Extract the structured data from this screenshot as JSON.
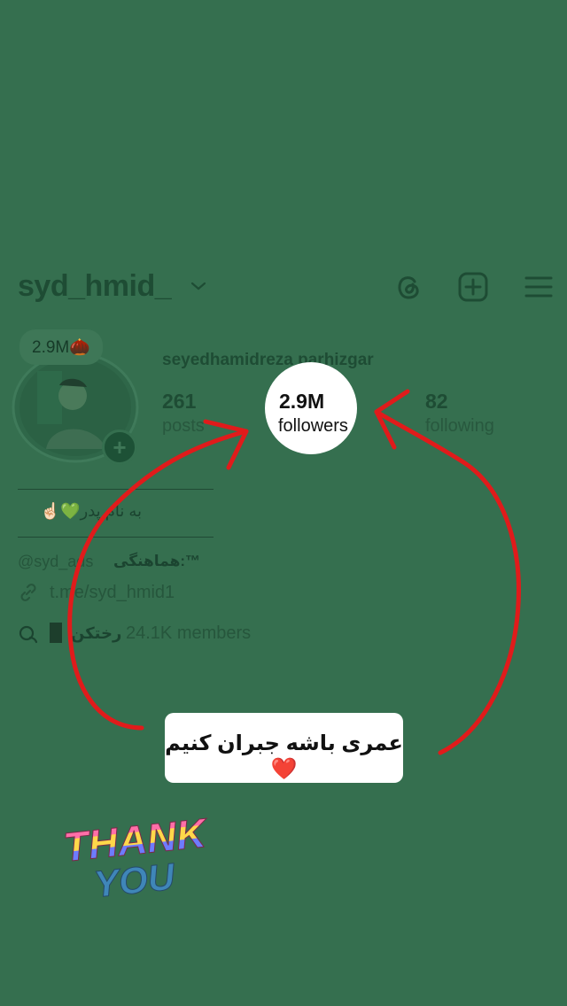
{
  "profile": {
    "username": "syd_hmid_",
    "full_name": "seyedhamidreza parhizgar",
    "note": "2.9M",
    "note_emoji": "🌰"
  },
  "stats": {
    "posts_count": "261",
    "posts_label": "posts",
    "followers_count": "2.9M",
    "followers_label": "followers",
    "following_count": "82",
    "following_label": "following"
  },
  "bio": {
    "divider": "_______________",
    "line1": "به نام پدر💚☝🏻",
    "mention": "@syd_ads",
    "coord_label": "هماهنگی:™",
    "link": "t.me/syd_hmid1",
    "channel_name": "رختکن",
    "channel_members": "24.1K members"
  },
  "story_overlay": {
    "caption": "عمری باشه جبران کنیم❤️",
    "sticker_line1": "THANK",
    "sticker_line2": "YOU"
  },
  "colors": {
    "background": "#356f4f",
    "arrow": "#e01b1b",
    "caption_bg": "#ffffff"
  },
  "icons": {
    "header": [
      "threads-icon",
      "new-post-icon",
      "menu-icon"
    ],
    "link": "link-icon",
    "channel": "channel-icon"
  }
}
